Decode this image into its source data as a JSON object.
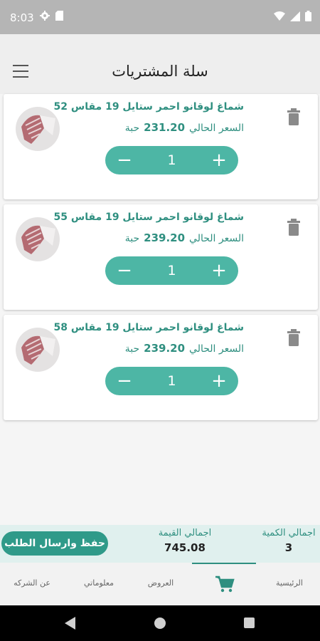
{
  "status_bar": {
    "time": "8:03",
    "icons": [
      "gear-icon",
      "sd-card-icon",
      "wifi-icon",
      "signal-icon",
      "battery-icon"
    ]
  },
  "app_bar": {
    "title": "سلة المشتريات",
    "menu_icon": "menu-icon"
  },
  "cart": {
    "items": [
      {
        "name": "شماغ لوقانو احمر ستايل 19 مقاس 52",
        "price_label": "السعر الحالي",
        "price": "231.20",
        "unit": "حبة",
        "quantity": "1"
      },
      {
        "name": "شماغ لوقانو احمر ستايل 19 مقاس 55",
        "price_label": "السعر الحالي",
        "price": "239.20",
        "unit": "حبة",
        "quantity": "1"
      },
      {
        "name": "شماغ لوقانو احمر ستايل 19 مقاس 58",
        "price_label": "السعر الحالي",
        "price": "239.20",
        "unit": "حبة",
        "quantity": "1"
      }
    ],
    "minus_symbol": "−",
    "plus_symbol": "+"
  },
  "summary": {
    "submit_label": "حفظ وارسال الطلب",
    "total_value_label": "اجمالي القيمة",
    "total_value": "745.08",
    "total_qty_label": "اجمالي الكمية",
    "total_qty": "3"
  },
  "bottom_nav": {
    "home": "الرئيسية",
    "cart_icon": "shopping-cart-icon",
    "offers": "العروض",
    "my_info": "معلوماتي",
    "about_company": "عن الشركه"
  },
  "colors": {
    "accent": "#4db6a5",
    "accent_dark": "#2f8f80",
    "summary_bg": "#e0f0ee"
  }
}
